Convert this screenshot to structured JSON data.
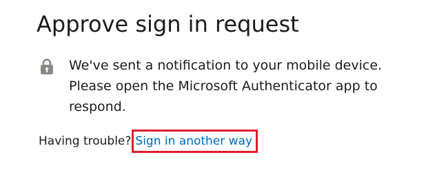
{
  "heading": "Approve sign in request",
  "notice": {
    "icon": "lock-icon",
    "text": "We've sent a notification to your mobile device. Please open the Microsoft Authenticator app to respond."
  },
  "trouble": {
    "label": "Having trouble?",
    "link": "Sign in another way"
  },
  "colors": {
    "text": "#1b1b1b",
    "link": "#0067b8",
    "highlight": "#e11d2a",
    "icon": "#8a8886"
  }
}
